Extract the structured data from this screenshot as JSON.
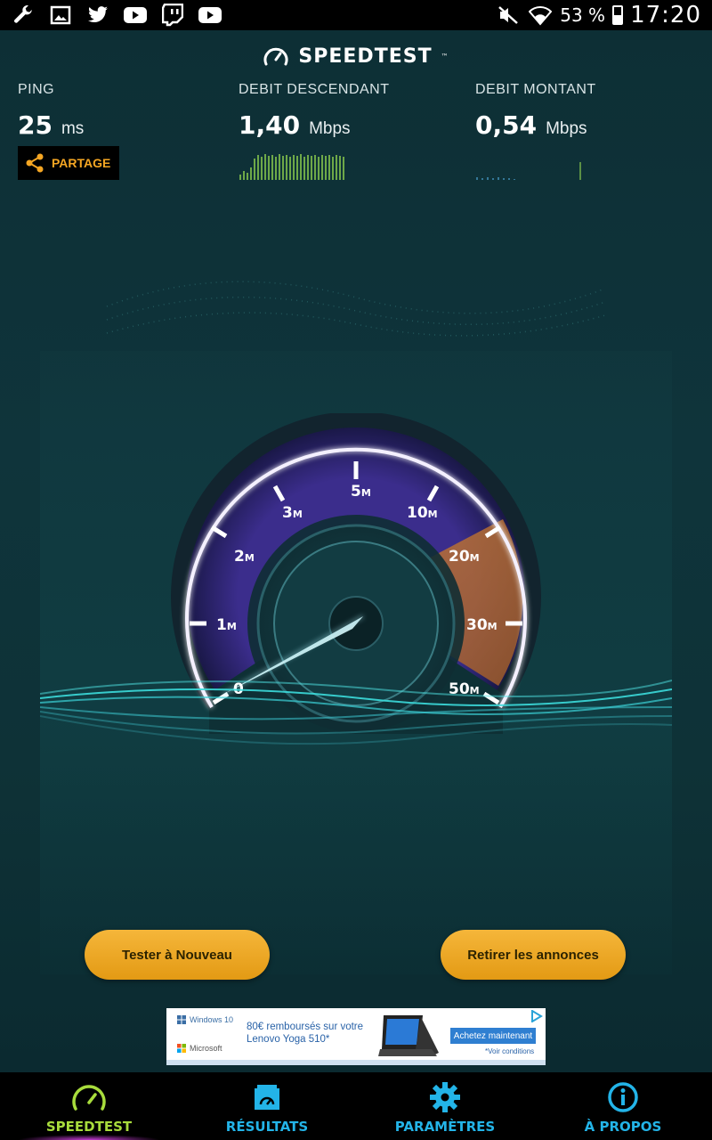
{
  "status_bar": {
    "battery": "53 %",
    "time": "17:20",
    "left_icons": [
      "wrench-icon",
      "gallery-icon",
      "twitter-icon",
      "youtube-icon",
      "twitch-icon",
      "youtube-icon"
    ],
    "right_icons": [
      "mute-icon",
      "wifi-icon",
      "battery-icon"
    ]
  },
  "header": {
    "logo": "SPEEDTEST",
    "trademark": "™"
  },
  "metrics": {
    "ping": {
      "label": "PING",
      "value": "25",
      "unit": "ms"
    },
    "download": {
      "label": "DEBIT DESCENDANT",
      "value": "1,40",
      "unit": "Mbps"
    },
    "upload": {
      "label": "DEBIT MONTANT",
      "value": "0,54",
      "unit": "Mbps"
    }
  },
  "share": {
    "label": "PARTAGE"
  },
  "gauge": {
    "ticks": [
      {
        "num": "0",
        "suffix": ""
      },
      {
        "num": "1",
        "suffix": "M"
      },
      {
        "num": "2",
        "suffix": "M"
      },
      {
        "num": "3",
        "suffix": "M"
      },
      {
        "num": "5",
        "suffix": "M"
      },
      {
        "num": "10",
        "suffix": "M"
      },
      {
        "num": "20",
        "suffix": "M"
      },
      {
        "num": "30",
        "suffix": "M"
      },
      {
        "num": "50",
        "suffix": "M"
      }
    ],
    "needle_value_mbps": 0.54
  },
  "actions": {
    "retest": "Tester à Nouveau",
    "remove_ads": "Retirer les annonces"
  },
  "ad": {
    "brand_top": "Windows 10",
    "brand_bottom": "Microsoft",
    "text_line1": "80€ remboursés sur votre",
    "text_line2": "Lenovo Yoga 510*",
    "cta": "Achetez maintenant",
    "conditions": "*Voir conditions"
  },
  "nav": {
    "items": [
      {
        "label": "SPEEDTEST",
        "icon": "speedometer-icon",
        "active": true
      },
      {
        "label": "RÉSULTATS",
        "icon": "results-icon",
        "active": false
      },
      {
        "label": "PARAMÈTRES",
        "icon": "gear-icon",
        "active": false
      },
      {
        "label": "À PROPOS",
        "icon": "info-icon",
        "active": false
      }
    ]
  },
  "colors": {
    "accent_orange": "#f5a623",
    "nav_blue": "#23b4e8",
    "nav_active": "#a8dc3c",
    "gauge_purple": "#6a4fd8"
  }
}
